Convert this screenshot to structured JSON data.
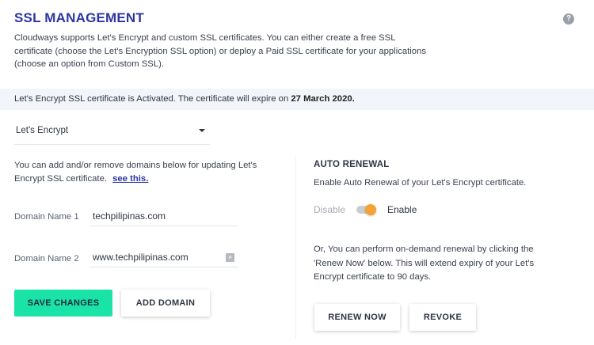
{
  "header": {
    "title": "SSL MANAGEMENT",
    "help_icon": "question-circle-icon",
    "help_glyph": "?"
  },
  "intro": "Cloudways supports Let's Encrypt and custom SSL certificates. You can either create a free SSL certificate (choose the Let's Encryption SSL option) or deploy a Paid SSL certificate for your applications (choose an option from Custom SSL).",
  "banner": {
    "text": "Let's Encrypt SSL certificate is Activated. The certificate will expire on",
    "date": "27 March 2020."
  },
  "ssl_type_select": {
    "selected": "Let's Encrypt"
  },
  "domains": {
    "description": "You can add and/or remove domains below for updating Let's Encrypt SSL certificate.",
    "link_text": "see this.",
    "fields": [
      {
        "label": "Domain Name 1",
        "value": "techpilipinas.com"
      },
      {
        "label": "Domain Name 2",
        "value": "www.techpilipinas.com"
      }
    ],
    "clear_glyph": "×",
    "save_label": "SAVE CHANGES",
    "add_label": "ADD DOMAIN"
  },
  "auto_renewal": {
    "title": "AUTO RENEWAL",
    "description": "Enable Auto Renewal of your Let's Encrypt certificate.",
    "disable_label": "Disable",
    "enable_label": "Enable",
    "enabled": true,
    "on_demand_text": "Or, You can perform on-demand renewal by clicking the 'Renew Now' below. This will extend expiry of your Let's Encrypt certificate to 90 days.",
    "renew_label": "RENEW NOW",
    "revoke_label": "REVOKE"
  },
  "colors": {
    "title": "#2c35a4",
    "primary_button": "#19e3a6",
    "toggle_knob": "#f5a133",
    "banner_bg": "#f2f6fb"
  }
}
